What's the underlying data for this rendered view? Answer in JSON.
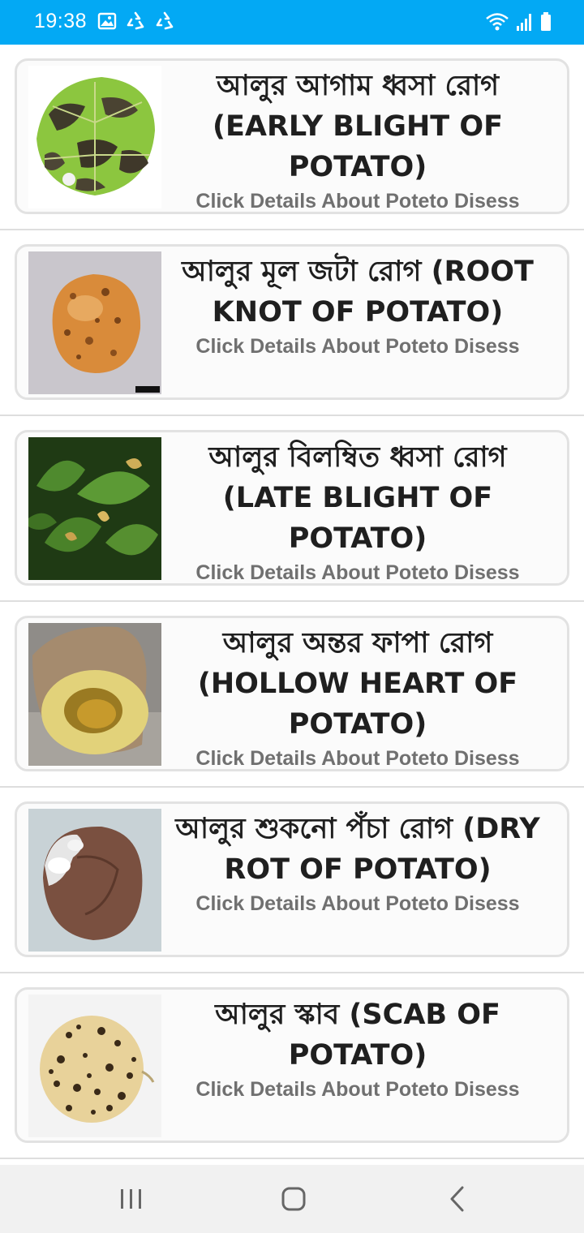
{
  "status_bar": {
    "time": "19:38",
    "left_icons": [
      "image-icon",
      "recycle-icon",
      "recycle-icon"
    ],
    "right_icons": [
      "wifi-icon",
      "signal-icon",
      "battery-icon"
    ],
    "bg_color": "#03a9f4"
  },
  "diseases": [
    {
      "title": "আলুর আগাম ধ্বসা রোগ (EARLY BLIGHT OF POTATO)",
      "subtitle": "Click Details About Poteto Disess",
      "image": "early-blight-leaf-image"
    },
    {
      "title": "আলুর মূল জটা রোগ (ROOT KNOT OF POTATO)",
      "subtitle": "Click Details About Poteto Disess",
      "image": "root-knot-potato-image"
    },
    {
      "title": "আলুর বিলম্বিত ধ্বসা রোগ (LATE BLIGHT OF POTATO)",
      "subtitle": "Click Details About Poteto Disess",
      "image": "late-blight-leaves-image"
    },
    {
      "title": "আলুর অন্তর ফাপা রোগ (HOLLOW HEART OF POTATO)",
      "subtitle": "Click Details About Poteto Disess",
      "image": "hollow-heart-potato-image"
    },
    {
      "title": "আলুর শুকনো পঁচা রোগ (DRY ROT OF POTATO)",
      "subtitle": "Click Details About Poteto Disess",
      "image": "dry-rot-potato-image"
    },
    {
      "title": "আলুর স্কাব (SCAB OF POTATO)",
      "subtitle": "Click Details About Poteto Disess",
      "image": "scab-potato-image"
    }
  ],
  "nav_bar": {
    "buttons": [
      "recent-apps-icon",
      "home-icon",
      "back-icon"
    ]
  }
}
